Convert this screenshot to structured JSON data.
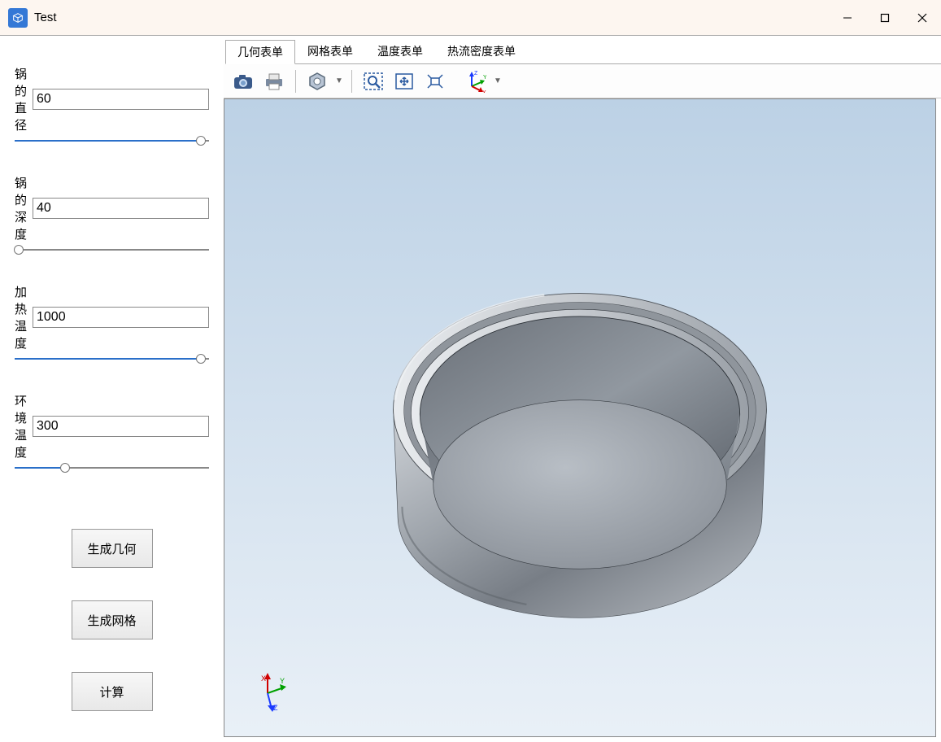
{
  "window": {
    "title": "Test"
  },
  "params": {
    "diameter": {
      "label": "锅的直径",
      "value": "60",
      "percent": 96
    },
    "depth": {
      "label": "锅的深度",
      "value": "40",
      "percent": 2
    },
    "heat": {
      "label": "加热温度",
      "value": "1000",
      "percent": 96
    },
    "env": {
      "label": "环境温度",
      "value": "300",
      "percent": 26
    }
  },
  "actions": {
    "gen_geom": "生成几何",
    "gen_mesh": "生成网格",
    "compute": "计算"
  },
  "tabs": {
    "geometry": "几何表单",
    "mesh": "网格表单",
    "temp": "温度表单",
    "flux": "热流密度表单"
  },
  "axes": {
    "x": "X",
    "y": "Y",
    "z": "Z"
  }
}
